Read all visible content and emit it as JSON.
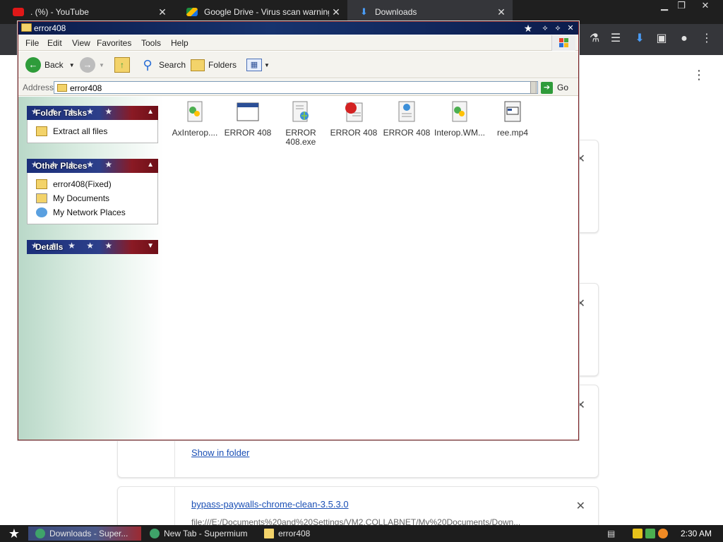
{
  "browser": {
    "tabs": [
      {
        "title": ". (%) - YouTube",
        "icon": "youtube-icon",
        "active": false
      },
      {
        "title": "Google Drive - Virus scan warning",
        "icon": "google-drive-icon",
        "active": false
      },
      {
        "title": "Downloads",
        "icon": "download-icon",
        "active": true
      }
    ],
    "downloads": {
      "show_in_folder": "Show in folder",
      "file_name": "bypass-paywalls-chrome-clean-3.5.3.0",
      "file_url": "file:///E:/Documents%20and%20Settings/VM2.COLLABNET/My%20Documents/Down..."
    }
  },
  "explorer": {
    "title": "error408",
    "menu": [
      "File",
      "Edit",
      "View",
      "Favorites",
      "Tools",
      "Help"
    ],
    "toolbar": {
      "back": "Back",
      "search": "Search",
      "folders": "Folders"
    },
    "address": {
      "label": "Address",
      "value": "error408",
      "go": "Go"
    },
    "panels": {
      "folder_tasks": {
        "title": "Folder Tasks",
        "items": [
          "Extract all files"
        ]
      },
      "other_places": {
        "title": "Other Places",
        "items": [
          "error408(Fixed)",
          "My Documents",
          "My Network Places"
        ]
      },
      "details": {
        "title": "Details"
      }
    },
    "files": [
      {
        "label": "AxInterop....",
        "icon": "dll-file-icon"
      },
      {
        "label": "ERROR 408",
        "icon": "application-window-icon"
      },
      {
        "label": "ERROR 408.exe",
        "icon": "exe-globe-icon"
      },
      {
        "label": "ERROR 408",
        "icon": "red-ball-document-icon"
      },
      {
        "label": "ERROR 408",
        "icon": "web-document-icon"
      },
      {
        "label": "Interop.WM...",
        "icon": "dll-file-icon"
      },
      {
        "label": "ree.mp4",
        "icon": "video-file-icon"
      }
    ]
  },
  "taskbar": {
    "items": [
      "Downloads - Super...",
      "New Tab - Supermium",
      "error408"
    ],
    "clock": "2:30 AM"
  },
  "colors": {
    "title_bar": "#0c1c4c",
    "panel_blue": "#1b2f7a",
    "panel_red": "#8a1a24",
    "link_blue": "#1a4fb5"
  }
}
